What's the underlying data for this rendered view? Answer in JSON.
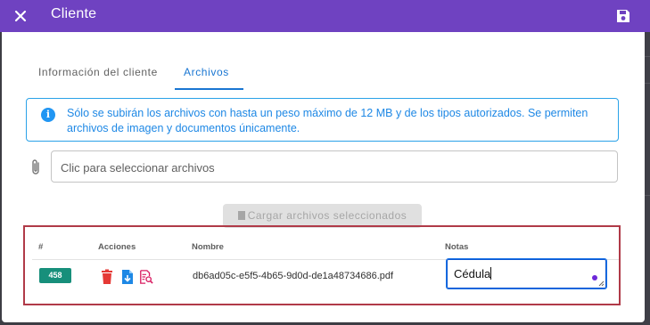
{
  "header": {
    "title": "Cliente",
    "close_icon": "close-icon",
    "save_icon": "save-icon"
  },
  "tabs": [
    {
      "label": "Información del cliente",
      "active": false
    },
    {
      "label": "Archivos",
      "active": true
    }
  ],
  "info": {
    "icon": "info-icon",
    "text": "Sólo se subirán los archivos con hasta un peso máximo de 12 MB y de los tipos autorizados. Se permiten archivos de imagen y documentos únicamente."
  },
  "file_input": {
    "icon": "paperclip-icon",
    "placeholder": "Clic para seleccionar archivos"
  },
  "upload_button": {
    "label": "Cargar archivos seleccionados",
    "icon": "document-icon",
    "disabled": true
  },
  "table": {
    "columns": [
      "#",
      "Acciones",
      "Nombre",
      "Notas"
    ],
    "rows": [
      {
        "id": "458",
        "actions": [
          "delete-icon",
          "download-icon",
          "preview-icon"
        ],
        "name": "db6ad05c-e5f5-4b65-9d0d-de1a48734686.pdf",
        "notes": "Cédula"
      }
    ]
  },
  "colors": {
    "header": "#6f42c1",
    "accent": "#1976d2",
    "badge": "#178f7b",
    "delete": "#e53935",
    "download": "#1e88e5",
    "preview": "#d81b60",
    "highlight_border": "#b03a48"
  }
}
